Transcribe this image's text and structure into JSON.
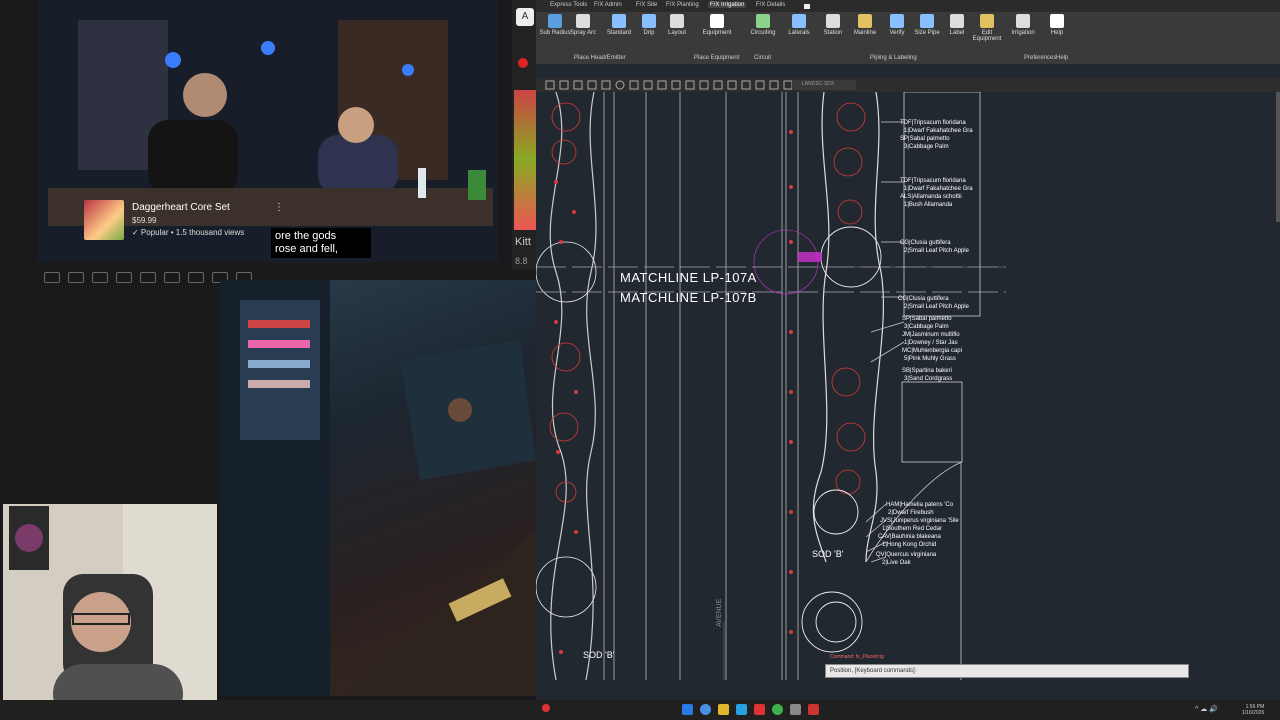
{
  "video": {
    "caption_line1": "ore the gods",
    "caption_line2": "rose and fell,",
    "promo": {
      "title": "Daggerheart Core Set",
      "price": "$59.99",
      "meta": "✓ Popular • 1.5 thousand views",
      "menu_icon": "⋮"
    }
  },
  "side_snippet": {
    "chip": "A",
    "label": "Kitt",
    "sub": "8.8"
  },
  "cad": {
    "ribbon_tabs": [
      "Express Tools",
      "F/X Admin",
      "F/X Site",
      "F/X Planting",
      "F/X Irrigation",
      "F/X Details"
    ],
    "active_tab": "F/X Irrigation",
    "ribbon_buttons": [
      {
        "label": "Sub Radius",
        "icon": "sprinkler-icon",
        "color": "#5aa0e0"
      },
      {
        "label": "Spray Arc",
        "icon": "arc-icon",
        "color": "#dddddd"
      },
      {
        "label": "Standard",
        "icon": "standard-icon",
        "color": "#88c0ff"
      },
      {
        "label": "Drip",
        "icon": "drip-icon",
        "color": "#88c0ff"
      },
      {
        "label": "Layout",
        "icon": "layout-icon",
        "color": "#dddddd"
      },
      {
        "label": "Equipment",
        "icon": "equipment-icon",
        "color": "#ffffff"
      },
      {
        "label": "Circuiting",
        "icon": "circuiting-icon",
        "color": "#8bd28b"
      },
      {
        "label": "Laterals",
        "icon": "laterals-icon",
        "color": "#88c0ff"
      },
      {
        "label": "Station",
        "icon": "station-icon",
        "color": "#dddddd"
      },
      {
        "label": "Mainline",
        "icon": "mainline-icon",
        "color": "#e0c060"
      },
      {
        "label": "Verify",
        "icon": "verify-icon",
        "color": "#88c0ff"
      },
      {
        "label": "Size Pipe",
        "icon": "sizepipe-icon",
        "color": "#88c0ff"
      },
      {
        "label": "Label",
        "icon": "label-icon",
        "color": "#dddddd"
      },
      {
        "label": "Edit Equipment",
        "icon": "edit-icon",
        "color": "#e0c060"
      },
      {
        "label": "Irrigation",
        "icon": "irrigation-icon",
        "color": "#dddddd"
      },
      {
        "label": "Help",
        "icon": "help-icon",
        "color": "#ffffff"
      }
    ],
    "ribbon_groups": [
      "Place Head/Emitter",
      "Place Equipment",
      "Circuit",
      "Piping & Labeling",
      "Preferences",
      "Help"
    ],
    "match_lines": [
      "MATCHLINE LP-107A",
      "MATCHLINE LP-107B"
    ],
    "sod_labels": [
      "SOD 'B'",
      "SOD 'B'"
    ],
    "street_label": "AVENUE",
    "plant_labels": [
      "TDF|Tripsacum floridana",
      "1|Dwarf Fakahatchee Gra",
      "SP|Sabal palmetto",
      "3|Cabbage Palm",
      "TDF|Tripsacum floridana",
      "1|Dwarf Fakahatchee Gra",
      "ALS|Allamanda schottii",
      "1|Bush Allamanda",
      "CG|Clusia guttifera",
      "2|Small Leaf Pitch Apple",
      "CG|Clusia guttifera",
      "2|Small Leaf Pitch Apple",
      "SP|Sabal palmetto",
      "3|Cabbage Palm",
      "JM|Jasminum multiflo",
      "1|Downey / Star Jas",
      "MC|Muhlenbergia capi",
      "5|Pink Muhly Grass",
      "SB|Spartina bakeri",
      "3|Sand Cordgrass",
      "HAM|Hamelia patens 'Co",
      "2|Dwarf Firebush",
      "JVS|Juniperus virginiana 'Sile",
      "1|Southern Red Cedar",
      "CAV|Bauhinia blakeana",
      "1|Hong Kong Orchid",
      "QV|Quercus virginiana",
      "2|Live Oak"
    ],
    "command_prev": "Command: fx_PlaceIrrig",
    "command_line": "Position, [Keyboard commands]:",
    "tab_dim": "LANDSC-SD3"
  },
  "taskbar": {
    "clock_time": "1:56 PM",
    "clock_date": "1/16/2026",
    "tray": "^  ☁  🔊"
  },
  "colors": {
    "cad_bg": "#212830",
    "plan_red": "#d83a3a",
    "magenta": "#d030d0"
  }
}
